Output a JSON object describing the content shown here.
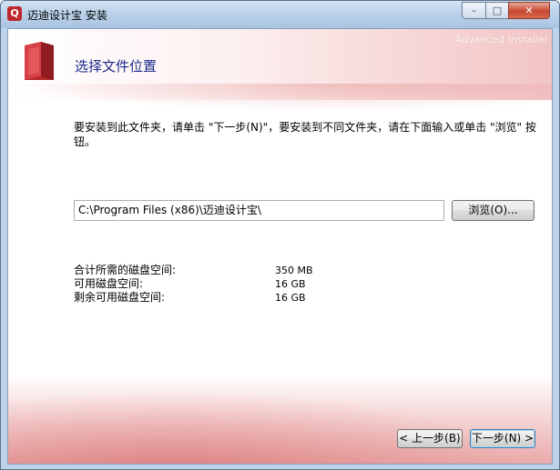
{
  "window": {
    "title": "迈迪设计宝 安装",
    "minimize_glyph": "–",
    "maximize_glyph": "□",
    "close_glyph": "✕",
    "app_icon": "installer-app-icon",
    "app_icon_glyph": "Q"
  },
  "header": {
    "title": "选择文件位置",
    "brand": "Advanced Installer",
    "icon": "folder-icon"
  },
  "body": {
    "instruction": "要安装到此文件夹，请单击 \"下一步(N)\"，要安装到不同文件夹，请在下面输入或单击 \"浏览\" 按钮。",
    "install_path": "C:\\Program Files (x86)\\迈迪设计宝\\",
    "browse_label": "浏览(O)..."
  },
  "disk_space": [
    {
      "label": "合计所需的磁盘空间:",
      "value": "350 MB"
    },
    {
      "label": "可用磁盘空间:",
      "value": "16 GB"
    },
    {
      "label": "剩余可用磁盘空间:",
      "value": "16 GB"
    }
  ],
  "footer": {
    "back_label": "< 上一步(B)",
    "next_label": "下一步(N) >"
  },
  "colors": {
    "title_text": "#1b2a8a",
    "accent_red": "#c0282d"
  }
}
